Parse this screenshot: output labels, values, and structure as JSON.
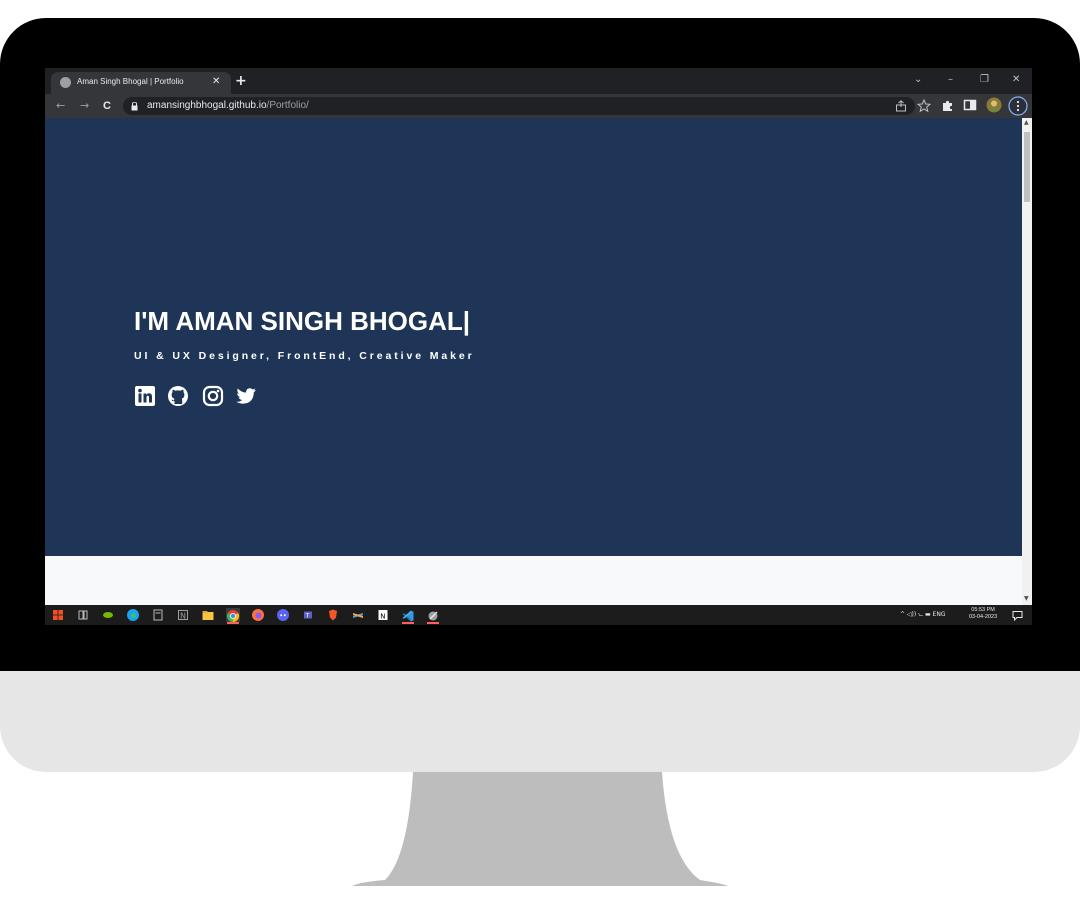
{
  "browser": {
    "tab_title": "Aman Singh Bhogal | Portfolio",
    "tab_close": "✕",
    "new_tab": "+",
    "url_host": "amansinghbhogal.github.io",
    "url_path": "/Portfolio/",
    "window_buttons": {
      "chevron": "⌄",
      "minimize": "–",
      "restore": "❐",
      "close": "✕"
    },
    "nav": {
      "back": "←",
      "forward": "→",
      "reload": "C"
    }
  },
  "page": {
    "hero_title": "I'M AMAN SINGH BHOGAL|",
    "hero_subtitle": "UI & UX Designer, FrontEnd, Creative Maker",
    "socials": [
      "linkedin-icon",
      "github-icon",
      "instagram-icon",
      "twitter-icon"
    ],
    "colors": {
      "hero_bg": "#1f3557",
      "page_bg": "#f8f9fa",
      "text": "#ffffff"
    }
  },
  "taskbar": {
    "tray_text": "^ ◁)) ⦦ ▬ ENG",
    "time": "05:53 PM",
    "date": "03-04-2023"
  }
}
